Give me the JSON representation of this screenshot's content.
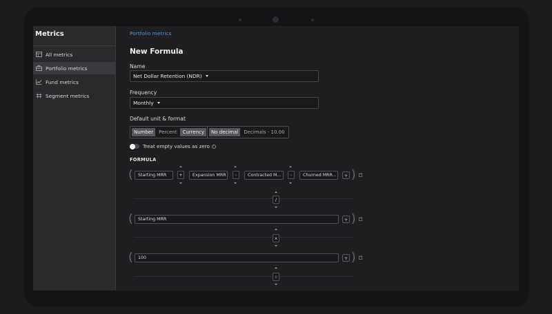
{
  "sidebar": {
    "title": "Metrics",
    "items": [
      {
        "label": "All metrics",
        "icon": "table-icon"
      },
      {
        "label": "Portfolio metrics",
        "icon": "briefcase-icon"
      },
      {
        "label": "Fund metrics",
        "icon": "chart-line-icon"
      },
      {
        "label": "Segment metrics",
        "icon": "segment-grid-icon"
      }
    ]
  },
  "breadcrumb": "Portfolio metrics",
  "form": {
    "title": "New Formula",
    "name_label": "Name",
    "name_value": "Net Dollar Retention (NDR)",
    "frequency_label": "Frequency",
    "frequency_value": "Monthly",
    "unit_label": "Default unit & format",
    "unit_options": [
      "Number",
      "Percent",
      "Currency"
    ],
    "format_options": [
      "No decimal",
      "Decimals - 10.00"
    ],
    "toggle_label": "Treat empty values as zero"
  },
  "formula": {
    "section_label": "FORMULA",
    "row1": {
      "terms": [
        "Starting MRR",
        "Expansion MRR",
        "Contracted M...",
        "Churned MRR..."
      ],
      "ops": [
        "+",
        "-",
        "-"
      ],
      "add": "+"
    },
    "op1": "/",
    "row2": {
      "term": "Starting MRR",
      "add": "+"
    },
    "op2": "x",
    "row3": {
      "term": "100",
      "add": "+"
    },
    "op3": "+"
  },
  "colors": {
    "accent": "#5a93d8",
    "background": "#1f1f21",
    "sidebar": "#2a2a2d"
  }
}
